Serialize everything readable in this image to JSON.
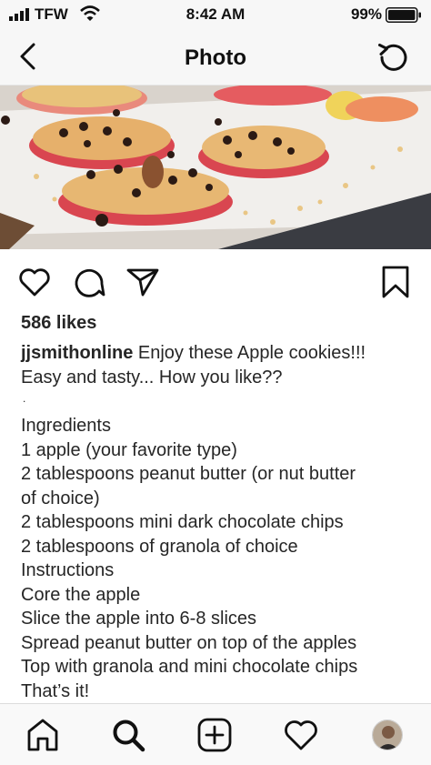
{
  "status_bar": {
    "carrier": "TFW",
    "time": "8:42 AM",
    "battery_pct": "99%"
  },
  "nav": {
    "title": "Photo"
  },
  "post": {
    "likes": "586 likes",
    "username": "jjsmithonline",
    "caption_first": " Enjoy these Apple cookies!!!",
    "caption_lines": [
      "Easy and tasty... How you like??",
      "Ingredients",
      "1 apple (your favorite type)",
      "2 tablespoons peanut butter (or nut butter",
      "of choice)",
      "2 tablespoons mini dark chocolate chips",
      "2 tablespoons of granola of choice",
      "Instructions",
      "Core the apple",
      "Slice the apple into 6-8 slices",
      "Spread peanut butter on top of the apples",
      "Top with granola and mini chocolate chips",
      "That’s it!"
    ],
    "dot": "."
  },
  "icons": {
    "back": "chevron-left-icon",
    "refresh": "refresh-icon",
    "like": "heart-icon",
    "comment": "comment-icon",
    "share": "send-icon",
    "save": "bookmark-icon",
    "home": "home-icon",
    "search": "search-icon",
    "new_post": "add-post-icon",
    "activity": "heart-icon"
  },
  "colors": {
    "text": "#262626",
    "bar_bg": "#f7f7f7"
  }
}
